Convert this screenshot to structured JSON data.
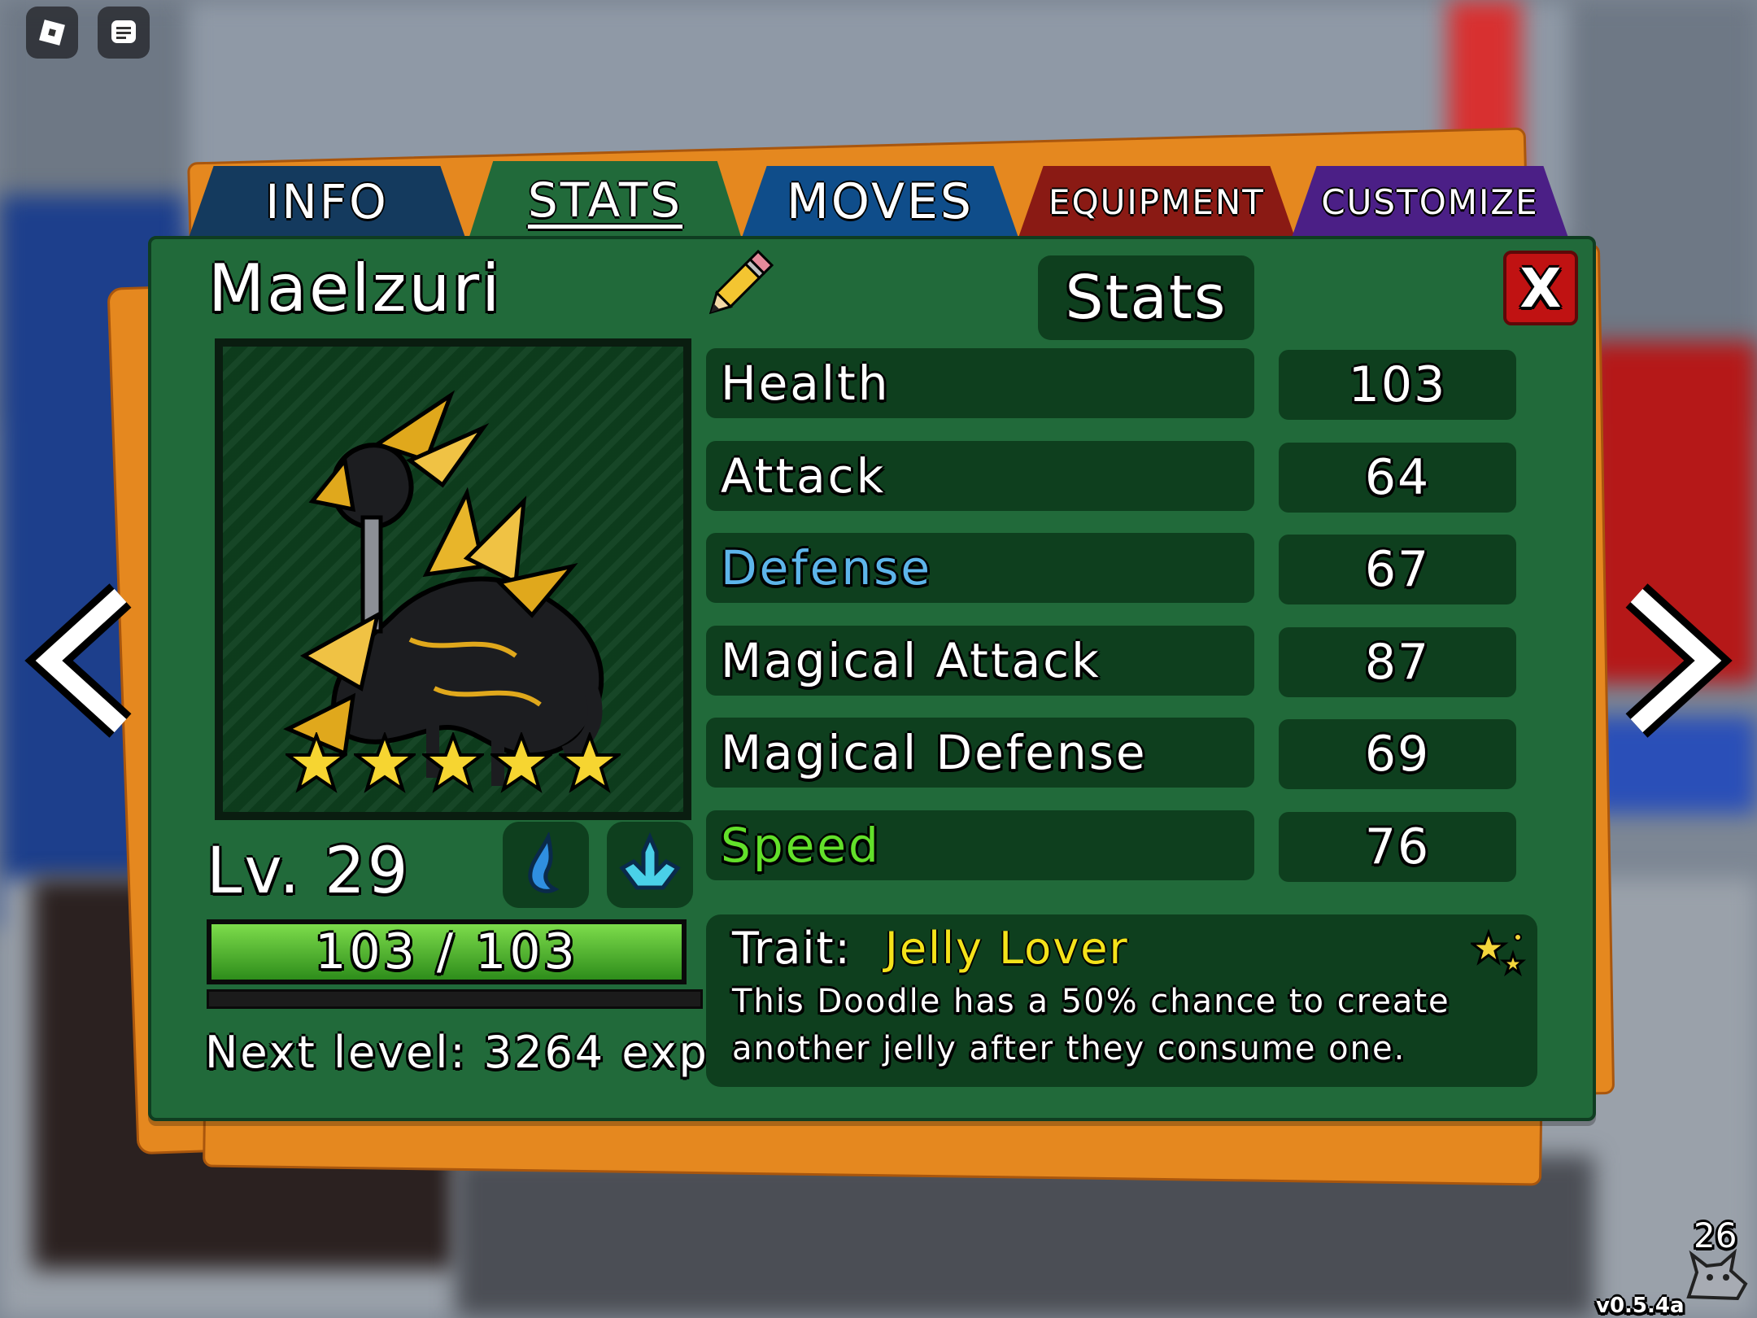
{
  "tabs": [
    {
      "label": "INFO",
      "color": "#143a5e"
    },
    {
      "label": "STATS",
      "color": "#216a3a",
      "active": true
    },
    {
      "label": "MOVES",
      "color": "#0f4d8a"
    },
    {
      "label": "EQUIPMENT",
      "color": "#8a1a14"
    },
    {
      "label": "CUSTOMIZE",
      "color": "#4b1f86"
    }
  ],
  "creature": {
    "name": "Maelzuri",
    "stars": 5,
    "level": "Lv. 29",
    "hp": "103 / 103",
    "hp_fraction": 1.0,
    "next_level": "Next level: 3264 exp",
    "types": [
      "water-drop-icon",
      "crystal-icon"
    ]
  },
  "stats_header": "Stats",
  "close_label": "X",
  "stats": [
    {
      "label": "Health",
      "value": "103",
      "color": "#ffffff"
    },
    {
      "label": "Attack",
      "value": "64",
      "color": "#ffffff"
    },
    {
      "label": "Defense",
      "value": "67",
      "color": "#5db5ea"
    },
    {
      "label": "Magical Attack",
      "value": "87",
      "color": "#ffffff"
    },
    {
      "label": "Magical Defense",
      "value": "69",
      "color": "#ffffff"
    },
    {
      "label": "Speed",
      "value": "76",
      "color": "#62e02a"
    }
  ],
  "trait": {
    "prefix": "Trait:",
    "name": "Jelly Lover",
    "name_color": "#f4e21a",
    "line1": "This Doodle has a 50% chance to create",
    "line2": "another jelly after they consume one."
  },
  "footer": {
    "player_count": "26",
    "version": "v0.5.4a"
  }
}
